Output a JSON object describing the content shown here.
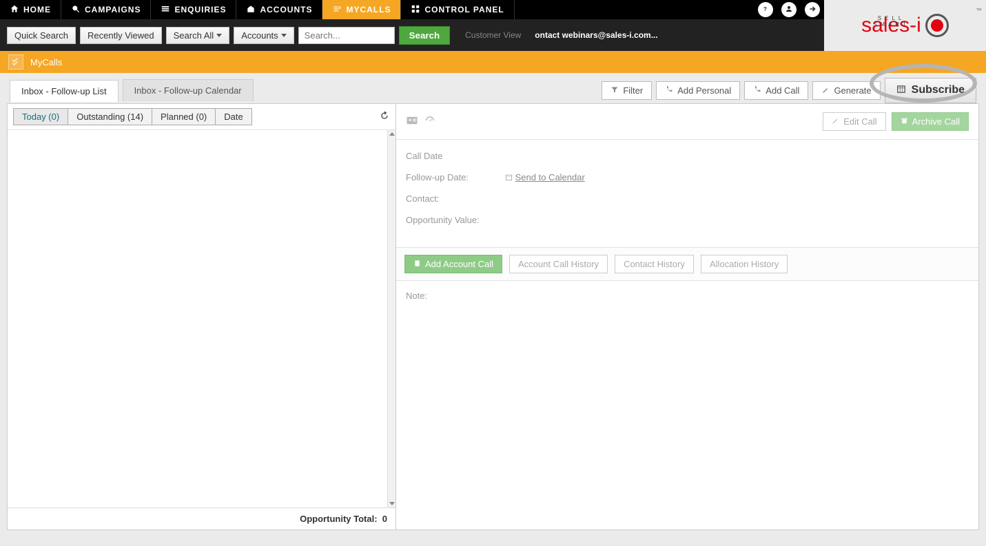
{
  "nav": {
    "home": "HOME",
    "campaigns": "CAMPAIGNS",
    "enquiries": "ENQUIRIES",
    "accounts": "ACCOUNTS",
    "mycalls": "MYCALLS",
    "control_panel": "CONTROL PANEL"
  },
  "logo": {
    "brand": "sales-i",
    "tag": "SELL SMART",
    "tm": "™"
  },
  "toolbar": {
    "quick_search": "Quick Search",
    "recently_viewed": "Recently Viewed",
    "search_all": "Search All",
    "accounts": "Accounts",
    "search_placeholder": "Search...",
    "search_btn": "Search",
    "customer_view": "Customer View",
    "customer_email": "ontact webinars@sales-i.com..."
  },
  "page_title": "MyCalls",
  "tabs": {
    "list": "Inbox - Follow-up List",
    "calendar": "Inbox - Follow-up Calendar"
  },
  "actions": {
    "filter": "Filter",
    "add_personal": "Add Personal",
    "add_call": "Add Call",
    "generate": "Generate",
    "subscribe": "Subscribe"
  },
  "segments": {
    "today": "Today (0)",
    "outstanding": "Outstanding (14)",
    "planned": "Planned (0)",
    "date": "Date"
  },
  "opportunity_total_label": "Opportunity Total:",
  "opportunity_total_value": "0",
  "detail": {
    "edit_call": "Edit Call",
    "archive_call": "Archive Call",
    "call_date": "Call Date",
    "followup_date": "Follow-up Date:",
    "send_to_calendar": "Send to Calendar",
    "contact": "Contact:",
    "opp_value": "Opportunity Value:",
    "add_account_call": "Add Account Call",
    "account_call_history": "Account Call History",
    "contact_history": "Contact History",
    "allocation_history": "Allocation History",
    "note": "Note:"
  }
}
